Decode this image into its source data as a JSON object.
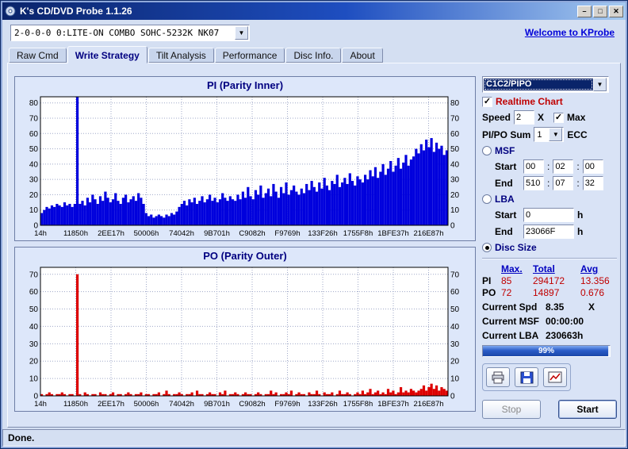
{
  "window": {
    "title": "K's CD/DVD Probe 1.1.26",
    "status": "Done."
  },
  "icons": {
    "minimize": "–",
    "maximize": "□",
    "close": "✕",
    "dropdown": "▼",
    "check": "✓"
  },
  "toolbar": {
    "drive_combo": "2-0-0-0 0:LITE-ON COMBO SOHC-5232K NK07",
    "link": "Welcome to KProbe"
  },
  "tabs": [
    {
      "label": "Raw Cmd"
    },
    {
      "label": "Write Strategy"
    },
    {
      "label": "Tilt Analysis"
    },
    {
      "label": "Performance"
    },
    {
      "label": "Disc Info."
    },
    {
      "label": "About"
    }
  ],
  "controls": {
    "mode_combo": "C1C2/PIPO",
    "realtime_label": "Realtime Chart",
    "realtime_checked": true,
    "speed_label": "Speed",
    "speed_value": "2",
    "speed_unit": "X",
    "max_label": "Max",
    "max_checked": true,
    "sum_label": "PI/PO Sum",
    "sum_value": "1",
    "sum_unit": "ECC",
    "msf": {
      "label": "MSF",
      "selected": false,
      "start_label": "Start",
      "end_label": "End",
      "start": [
        "00",
        "02",
        "00"
      ],
      "end": [
        "510",
        "07",
        "32"
      ]
    },
    "lba": {
      "label": "LBA",
      "selected": false,
      "start_label": "Start",
      "end_label": "End",
      "start": "0",
      "end": "23066F",
      "unit": "h"
    },
    "disc_size": {
      "label": "Disc Size",
      "selected": true
    },
    "stats": {
      "headers": [
        "Max.",
        "Total",
        "Avg"
      ],
      "rows": [
        {
          "label": "PI",
          "max": "85",
          "total": "294172",
          "avg": "13.356"
        },
        {
          "label": "PO",
          "max": "72",
          "total": "14897",
          "avg": "0.676"
        }
      ]
    },
    "current": [
      {
        "label": "Current Spd",
        "value": "8.35",
        "suffix": "X"
      },
      {
        "label": "Current MSF",
        "value": "00:00:00",
        "suffix": ""
      },
      {
        "label": "Current LBA",
        "value": "230663h",
        "suffix": ""
      }
    ],
    "progress": {
      "percent": 99,
      "label": "99%"
    },
    "actions": {
      "stop": "Stop",
      "start": "Start"
    }
  },
  "chart_data": [
    {
      "type": "bar",
      "title": "PI (Parity Inner)",
      "x_labels": [
        "14h",
        "11850h",
        "2EE17h",
        "50006h",
        "74042h",
        "9B701h",
        "C9082h",
        "F9769h",
        "133F26h",
        "1755F8h",
        "1BFE37h",
        "216E87h"
      ],
      "yticks": [
        0,
        10,
        20,
        30,
        40,
        50,
        60,
        70,
        80
      ],
      "ylim": [
        0,
        84
      ],
      "color": "#0000dd",
      "values": [
        8,
        10,
        12,
        11,
        13,
        12,
        14,
        13,
        12,
        15,
        13,
        14,
        12,
        14,
        85,
        14,
        16,
        13,
        18,
        15,
        20,
        17,
        14,
        19,
        16,
        22,
        18,
        15,
        17,
        21,
        16,
        14,
        18,
        20,
        15,
        17,
        19,
        16,
        21,
        18,
        14,
        8,
        6,
        7,
        5,
        6,
        7,
        6,
        5,
        7,
        6,
        8,
        7,
        9,
        12,
        14,
        16,
        13,
        17,
        15,
        18,
        14,
        16,
        19,
        15,
        17,
        20,
        16,
        18,
        15,
        17,
        21,
        18,
        16,
        19,
        17,
        16,
        20,
        17,
        22,
        18,
        25,
        19,
        17,
        23,
        20,
        26,
        18,
        21,
        24,
        19,
        27,
        22,
        18,
        25,
        21,
        28,
        20,
        23,
        26,
        22,
        20,
        24,
        21,
        27,
        23,
        29,
        25,
        22,
        28,
        24,
        31,
        26,
        23,
        29,
        27,
        33,
        25,
        28,
        31,
        27,
        34,
        29,
        26,
        32,
        30,
        28,
        33,
        30,
        36,
        32,
        38,
        31,
        35,
        40,
        33,
        37,
        42,
        35,
        39,
        44,
        37,
        41,
        46,
        39,
        43,
        45,
        50,
        47,
        53,
        49,
        56,
        51,
        57,
        48,
        54,
        50,
        52,
        46,
        49
      ]
    },
    {
      "type": "bar",
      "title": "PO (Parity Outer)",
      "x_labels": [
        "14h",
        "11850h",
        "2EE17h",
        "50006h",
        "74042h",
        "9B701h",
        "C9082h",
        "F9769h",
        "133F26h",
        "1755F8h",
        "1BFE37h",
        "216E87h"
      ],
      "yticks": [
        0,
        10,
        20,
        30,
        40,
        50,
        60,
        70
      ],
      "ylim": [
        0,
        74
      ],
      "color": "#dd0000",
      "values": [
        1,
        0,
        1,
        2,
        1,
        0,
        1,
        1,
        2,
        1,
        0,
        1,
        1,
        0,
        70,
        1,
        0,
        2,
        1,
        0,
        1,
        1,
        0,
        2,
        1,
        1,
        0,
        1,
        2,
        0,
        1,
        1,
        0,
        1,
        2,
        1,
        0,
        1,
        1,
        2,
        0,
        1,
        1,
        0,
        1,
        1,
        2,
        0,
        1,
        3,
        1,
        0,
        1,
        1,
        2,
        1,
        0,
        1,
        1,
        2,
        0,
        3,
        1,
        1,
        0,
        1,
        2,
        1,
        1,
        0,
        2,
        1,
        3,
        0,
        1,
        1,
        2,
        1,
        0,
        1,
        2,
        1,
        1,
        0,
        1,
        2,
        1,
        0,
        1,
        1,
        3,
        1,
        2,
        0,
        1,
        1,
        2,
        1,
        3,
        0,
        1,
        2,
        1,
        1,
        0,
        2,
        1,
        1,
        3,
        1,
        0,
        2,
        1,
        1,
        2,
        0,
        1,
        3,
        1,
        1,
        2,
        1,
        0,
        1,
        2,
        1,
        3,
        1,
        2,
        4,
        1,
        2,
        3,
        1,
        2,
        1,
        4,
        2,
        3,
        1,
        2,
        5,
        2,
        3,
        2,
        4,
        3,
        2,
        3,
        4,
        6,
        3,
        5,
        7,
        4,
        6,
        3,
        5,
        4,
        3
      ]
    }
  ]
}
